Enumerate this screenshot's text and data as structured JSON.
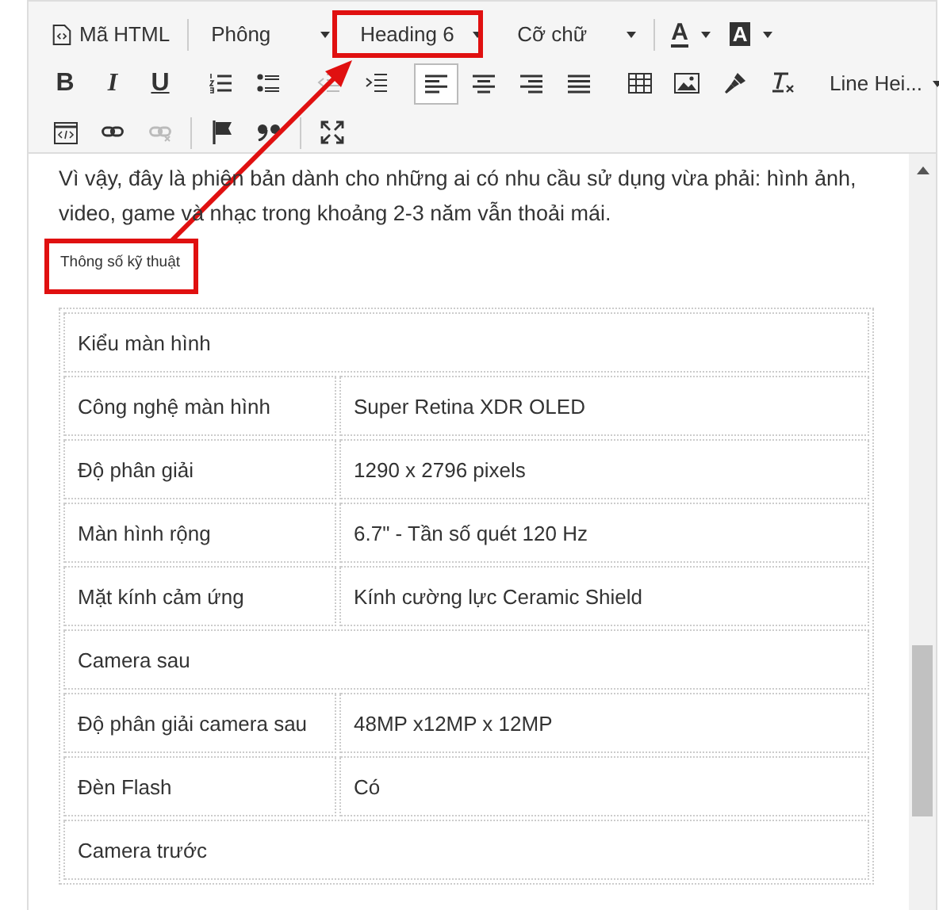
{
  "toolbar": {
    "html_button": "Mã HTML",
    "font": "Phông",
    "format": "Heading 6",
    "size": "Cỡ chữ",
    "text_color": "A",
    "bg_color": "A",
    "bold": "B",
    "italic": "I",
    "underline": "U",
    "line_height": "Line Hei...",
    "indent": [
      {
        "disabled": true
      },
      {
        "disabled": false
      }
    ],
    "align": [
      {
        "selected": true
      },
      {
        "selected": false
      },
      {
        "selected": false
      },
      {
        "selected": false
      }
    ],
    "links": [
      {
        "disabled": false
      },
      {
        "disabled": true
      }
    ]
  },
  "content": {
    "paragraph": "Vì vậy, đây là phiên bản dành cho những ai có nhu cầu sử dụng vừa phải: hình ảnh, video, game và nhạc trong khoảng 2-3 năm vẫn thoải mái.",
    "heading": "Thông số kỹ thuật",
    "table": [
      {
        "kind": "section",
        "label": "Kiểu màn hình"
      },
      {
        "kind": "pair",
        "label": "Công nghệ màn hình",
        "value": "Super Retina XDR OLED"
      },
      {
        "kind": "pair",
        "label": "Độ phân giải",
        "value": "1290 x 2796 pixels"
      },
      {
        "kind": "pair",
        "label": "Màn hình rộng",
        "value": "6.7\" - Tần số quét 120 Hz"
      },
      {
        "kind": "pair",
        "label": "Mặt kính cảm ứng",
        "value": "Kính cường lực Ceramic Shield"
      },
      {
        "kind": "section",
        "label": "Camera sau"
      },
      {
        "kind": "pair",
        "label": "Độ phân giải camera sau",
        "value": "48MP x12MP x 12MP"
      },
      {
        "kind": "pair",
        "label": "Đèn Flash",
        "value": "Có"
      },
      {
        "kind": "section",
        "label": "Camera trước"
      }
    ]
  }
}
